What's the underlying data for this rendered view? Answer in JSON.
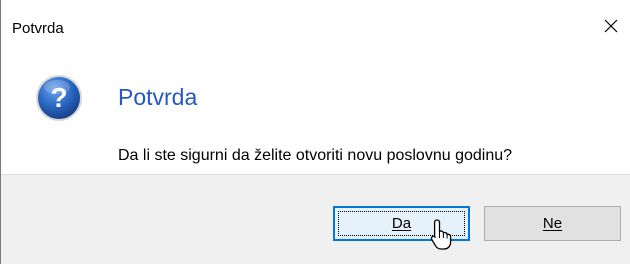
{
  "window": {
    "title": "Potvrda"
  },
  "dialog": {
    "instruction": "Potvrda",
    "message": "Da li ste sigurni da želite otvoriti novu poslovnu godinu?"
  },
  "buttons": {
    "yes_label": "Da",
    "no_label": "Ne"
  },
  "icons": {
    "dialog_icon": "question-icon",
    "close": "close-icon",
    "pointer": "hand-cursor-icon"
  },
  "colors": {
    "instruction_text": "#2459c4",
    "question_icon_fill": "#1f5fb5",
    "default_button_border": "#0078d7",
    "footer_bg": "#f0f0f0"
  }
}
